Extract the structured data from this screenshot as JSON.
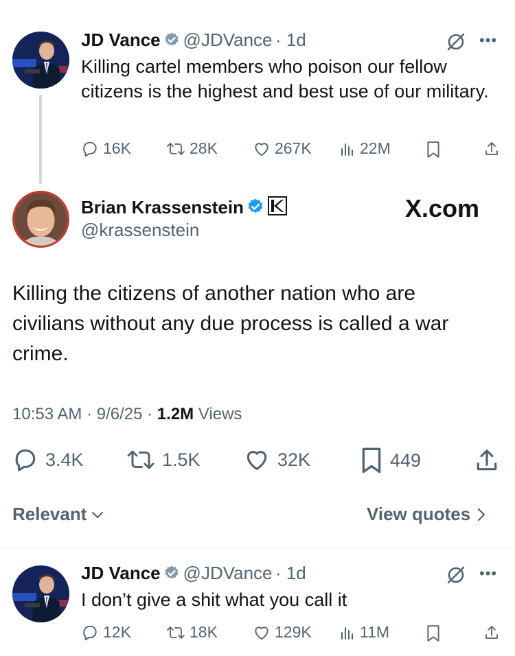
{
  "tweet1": {
    "name": "JD Vance",
    "handle": "@JDVance",
    "time": "· 1d",
    "text": "Killing cartel members who poison our fellow citizens is the highest and best use of our military.",
    "replies": "16K",
    "reposts": "28K",
    "likes": "267K",
    "views": "22M"
  },
  "main_tweet": {
    "name": "Brian Krassenstein",
    "handle": "@krassenstein",
    "watermark": "X.com",
    "text": "Killing the citizens of another nation who are civilians without any due process is called a war crime.",
    "timestamp": "10:53 AM · 9/6/25 · ",
    "views_count": "1.2M",
    "views_label": "Views",
    "replies": "3.4K",
    "reposts": "1.5K",
    "likes": "32K",
    "bookmarks": "449"
  },
  "filters": {
    "relevant_label": "Relevant",
    "view_quotes_label": "View quotes"
  },
  "tweet3": {
    "name": "JD Vance",
    "handle": "@JDVance",
    "time": "· 1d",
    "text": "I don’t give a shit what you call it",
    "replies": "12K",
    "reposts": "18K",
    "likes": "129K",
    "views": "11M"
  },
  "colors": {
    "verified_blue": "#1d9bf0",
    "text_secondary": "#536471",
    "text_primary": "#0f1419"
  }
}
